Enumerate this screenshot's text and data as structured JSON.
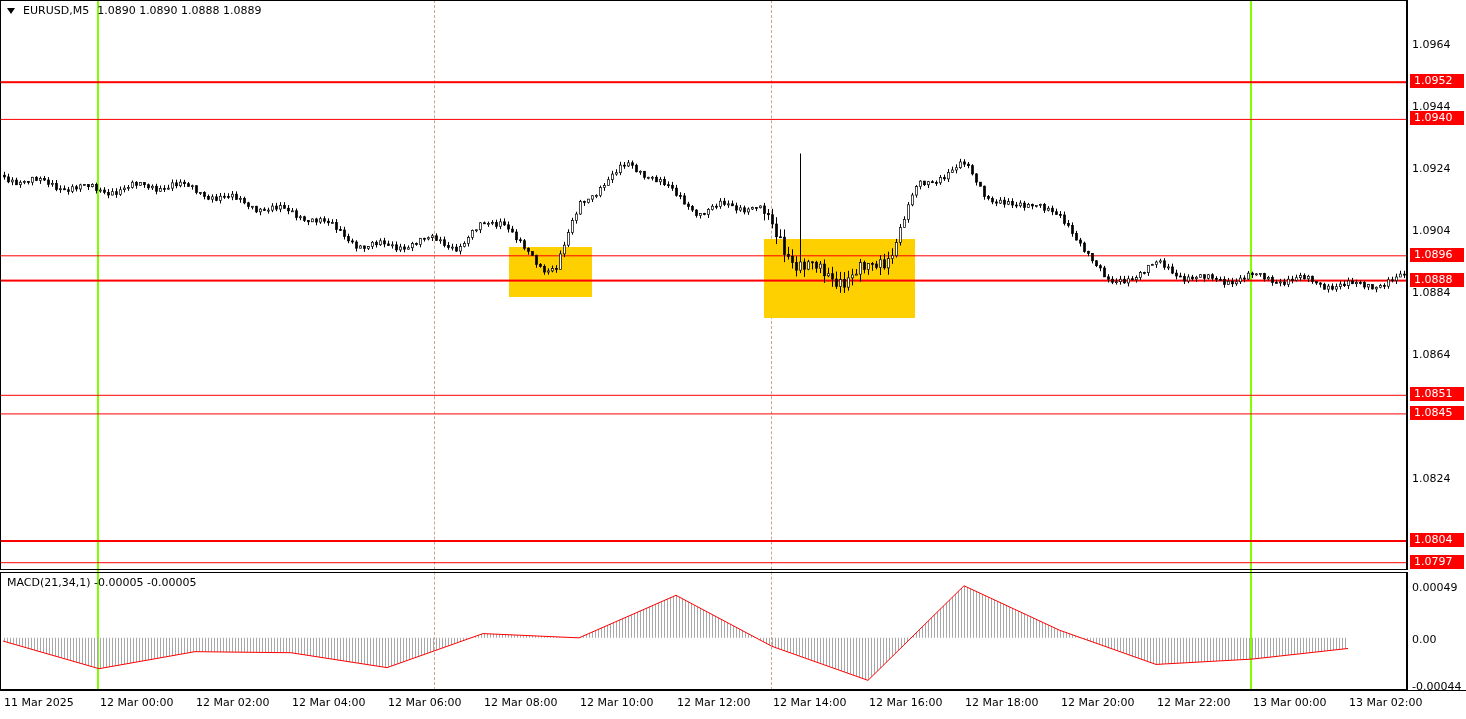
{
  "header": {
    "symbol": "EURUSD,M5",
    "ohlc": "1.0890 1.0890 1.0888 1.0889"
  },
  "price_ticks": [
    "1.0964",
    "1.0944",
    "1.0924",
    "1.0904",
    "1.0884",
    "1.0864",
    "1.0824"
  ],
  "levels": [
    {
      "label": "1.0952",
      "thick": true
    },
    {
      "label": "1.0940",
      "thick": false
    },
    {
      "label": "1.0896",
      "thick": false
    },
    {
      "label": "1.0888",
      "thick": true
    },
    {
      "label": "1.0851",
      "thick": false
    },
    {
      "label": "1.0845",
      "thick": false
    },
    {
      "label": "1.0804",
      "thick": true
    },
    {
      "label": "1.0797",
      "thick": false
    }
  ],
  "macd": {
    "label": "MACD(21,34,1) -0.00005 -0.00005",
    "chart_data": {
      "type": "area",
      "categories": [
        "11 Mar 2025",
        "12 Mar 00:00",
        "12 Mar 02:00",
        "12 Mar 04:00",
        "12 Mar 06:00",
        "12 Mar 08:00",
        "12 Mar 10:00",
        "12 Mar 12:00",
        "12 Mar 14:00",
        "12 Mar 16:00",
        "12 Mar 18:00",
        "12 Mar 20:00",
        "12 Mar 22:00",
        "13 Mar 00:00",
        "13 Mar 02:00"
      ],
      "series": [
        {
          "color": "#ff0000",
          "values": [
            -3e-05,
            -0.00029,
            -0.00013,
            -0.00014,
            -0.00028,
            4e-05,
            0.0,
            0.0004,
            -8e-05,
            -0.0004,
            0.00049,
            7e-05,
            -0.00025,
            -0.0002,
            -0.0001
          ]
        }
      ],
      "ylim": [
        -0.0005,
        0.00061
      ],
      "yticks": [
        {
          "value": 0.00049,
          "label": "0.00049"
        },
        {
          "value": 0,
          "label": "0.00"
        },
        {
          "value": -0.00044,
          "label": "-0.00044"
        }
      ]
    }
  }
}
